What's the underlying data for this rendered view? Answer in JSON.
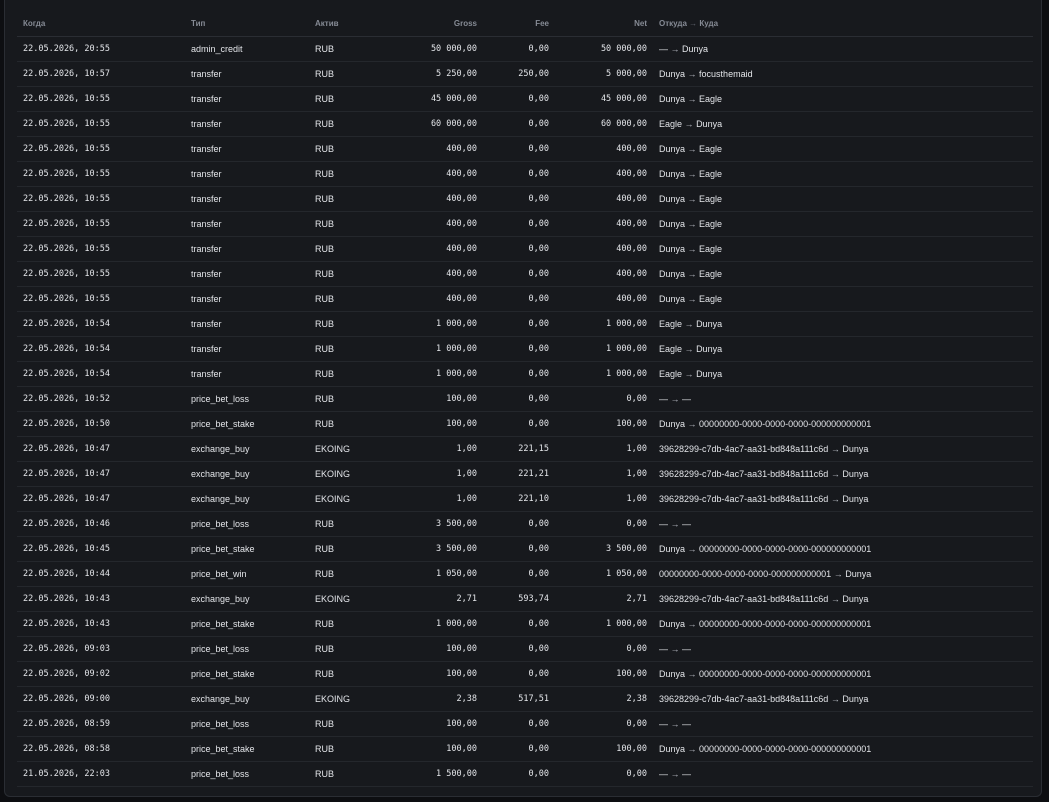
{
  "headers": {
    "when": "Когда",
    "type": "Тип",
    "asset": "Актив",
    "gross": "Gross",
    "fee": "Fee",
    "net": "Net",
    "from": "Откуда",
    "arrow": "→",
    "to": "Куда"
  },
  "rows": [
    {
      "when": "22.05.2026, 20:55",
      "type": "admin_credit",
      "asset": "RUB",
      "gross": "50 000,00",
      "fee": "0,00",
      "net": "50 000,00",
      "from": "—",
      "to": "Dunya"
    },
    {
      "when": "22.05.2026, 10:57",
      "type": "transfer",
      "asset": "RUB",
      "gross": "5 250,00",
      "fee": "250,00",
      "net": "5 000,00",
      "from": "Dunya",
      "to": "focusthemaid"
    },
    {
      "when": "22.05.2026, 10:55",
      "type": "transfer",
      "asset": "RUB",
      "gross": "45 000,00",
      "fee": "0,00",
      "net": "45 000,00",
      "from": "Dunya",
      "to": "Eagle"
    },
    {
      "when": "22.05.2026, 10:55",
      "type": "transfer",
      "asset": "RUB",
      "gross": "60 000,00",
      "fee": "0,00",
      "net": "60 000,00",
      "from": "Eagle",
      "to": "Dunya"
    },
    {
      "when": "22.05.2026, 10:55",
      "type": "transfer",
      "asset": "RUB",
      "gross": "400,00",
      "fee": "0,00",
      "net": "400,00",
      "from": "Dunya",
      "to": "Eagle"
    },
    {
      "when": "22.05.2026, 10:55",
      "type": "transfer",
      "asset": "RUB",
      "gross": "400,00",
      "fee": "0,00",
      "net": "400,00",
      "from": "Dunya",
      "to": "Eagle"
    },
    {
      "when": "22.05.2026, 10:55",
      "type": "transfer",
      "asset": "RUB",
      "gross": "400,00",
      "fee": "0,00",
      "net": "400,00",
      "from": "Dunya",
      "to": "Eagle"
    },
    {
      "when": "22.05.2026, 10:55",
      "type": "transfer",
      "asset": "RUB",
      "gross": "400,00",
      "fee": "0,00",
      "net": "400,00",
      "from": "Dunya",
      "to": "Eagle"
    },
    {
      "when": "22.05.2026, 10:55",
      "type": "transfer",
      "asset": "RUB",
      "gross": "400,00",
      "fee": "0,00",
      "net": "400,00",
      "from": "Dunya",
      "to": "Eagle"
    },
    {
      "when": "22.05.2026, 10:55",
      "type": "transfer",
      "asset": "RUB",
      "gross": "400,00",
      "fee": "0,00",
      "net": "400,00",
      "from": "Dunya",
      "to": "Eagle"
    },
    {
      "when": "22.05.2026, 10:55",
      "type": "transfer",
      "asset": "RUB",
      "gross": "400,00",
      "fee": "0,00",
      "net": "400,00",
      "from": "Dunya",
      "to": "Eagle"
    },
    {
      "when": "22.05.2026, 10:54",
      "type": "transfer",
      "asset": "RUB",
      "gross": "1 000,00",
      "fee": "0,00",
      "net": "1 000,00",
      "from": "Eagle",
      "to": "Dunya"
    },
    {
      "when": "22.05.2026, 10:54",
      "type": "transfer",
      "asset": "RUB",
      "gross": "1 000,00",
      "fee": "0,00",
      "net": "1 000,00",
      "from": "Eagle",
      "to": "Dunya"
    },
    {
      "when": "22.05.2026, 10:54",
      "type": "transfer",
      "asset": "RUB",
      "gross": "1 000,00",
      "fee": "0,00",
      "net": "1 000,00",
      "from": "Eagle",
      "to": "Dunya"
    },
    {
      "when": "22.05.2026, 10:52",
      "type": "price_bet_loss",
      "asset": "RUB",
      "gross": "100,00",
      "fee": "0,00",
      "net": "0,00",
      "from": "—",
      "to": "—"
    },
    {
      "when": "22.05.2026, 10:50",
      "type": "price_bet_stake",
      "asset": "RUB",
      "gross": "100,00",
      "fee": "0,00",
      "net": "100,00",
      "from": "Dunya",
      "to": "00000000-0000-0000-0000-000000000001"
    },
    {
      "when": "22.05.2026, 10:47",
      "type": "exchange_buy",
      "asset": "EKOING",
      "gross": "1,00",
      "fee": "221,15",
      "net": "1,00",
      "from": "39628299-c7db-4ac7-aa31-bd848a111c6d",
      "to": "Dunya"
    },
    {
      "when": "22.05.2026, 10:47",
      "type": "exchange_buy",
      "asset": "EKOING",
      "gross": "1,00",
      "fee": "221,21",
      "net": "1,00",
      "from": "39628299-c7db-4ac7-aa31-bd848a111c6d",
      "to": "Dunya"
    },
    {
      "when": "22.05.2026, 10:47",
      "type": "exchange_buy",
      "asset": "EKOING",
      "gross": "1,00",
      "fee": "221,10",
      "net": "1,00",
      "from": "39628299-c7db-4ac7-aa31-bd848a111c6d",
      "to": "Dunya"
    },
    {
      "when": "22.05.2026, 10:46",
      "type": "price_bet_loss",
      "asset": "RUB",
      "gross": "3 500,00",
      "fee": "0,00",
      "net": "0,00",
      "from": "—",
      "to": "—"
    },
    {
      "when": "22.05.2026, 10:45",
      "type": "price_bet_stake",
      "asset": "RUB",
      "gross": "3 500,00",
      "fee": "0,00",
      "net": "3 500,00",
      "from": "Dunya",
      "to": "00000000-0000-0000-0000-000000000001"
    },
    {
      "when": "22.05.2026, 10:44",
      "type": "price_bet_win",
      "asset": "RUB",
      "gross": "1 050,00",
      "fee": "0,00",
      "net": "1 050,00",
      "from": "00000000-0000-0000-0000-000000000001",
      "to": "Dunya"
    },
    {
      "when": "22.05.2026, 10:43",
      "type": "exchange_buy",
      "asset": "EKOING",
      "gross": "2,71",
      "fee": "593,74",
      "net": "2,71",
      "from": "39628299-c7db-4ac7-aa31-bd848a111c6d",
      "to": "Dunya"
    },
    {
      "when": "22.05.2026, 10:43",
      "type": "price_bet_stake",
      "asset": "RUB",
      "gross": "1 000,00",
      "fee": "0,00",
      "net": "1 000,00",
      "from": "Dunya",
      "to": "00000000-0000-0000-0000-000000000001"
    },
    {
      "when": "22.05.2026, 09:03",
      "type": "price_bet_loss",
      "asset": "RUB",
      "gross": "100,00",
      "fee": "0,00",
      "net": "0,00",
      "from": "—",
      "to": "—"
    },
    {
      "when": "22.05.2026, 09:02",
      "type": "price_bet_stake",
      "asset": "RUB",
      "gross": "100,00",
      "fee": "0,00",
      "net": "100,00",
      "from": "Dunya",
      "to": "00000000-0000-0000-0000-000000000001"
    },
    {
      "when": "22.05.2026, 09:00",
      "type": "exchange_buy",
      "asset": "EKOING",
      "gross": "2,38",
      "fee": "517,51",
      "net": "2,38",
      "from": "39628299-c7db-4ac7-aa31-bd848a111c6d",
      "to": "Dunya"
    },
    {
      "when": "22.05.2026, 08:59",
      "type": "price_bet_loss",
      "asset": "RUB",
      "gross": "100,00",
      "fee": "0,00",
      "net": "0,00",
      "from": "—",
      "to": "—"
    },
    {
      "when": "22.05.2026, 08:58",
      "type": "price_bet_stake",
      "asset": "RUB",
      "gross": "100,00",
      "fee": "0,00",
      "net": "100,00",
      "from": "Dunya",
      "to": "00000000-0000-0000-0000-000000000001"
    },
    {
      "when": "21.05.2026, 22:03",
      "type": "price_bet_loss",
      "asset": "RUB",
      "gross": "1 500,00",
      "fee": "0,00",
      "net": "0,00",
      "from": "—",
      "to": "—"
    }
  ]
}
